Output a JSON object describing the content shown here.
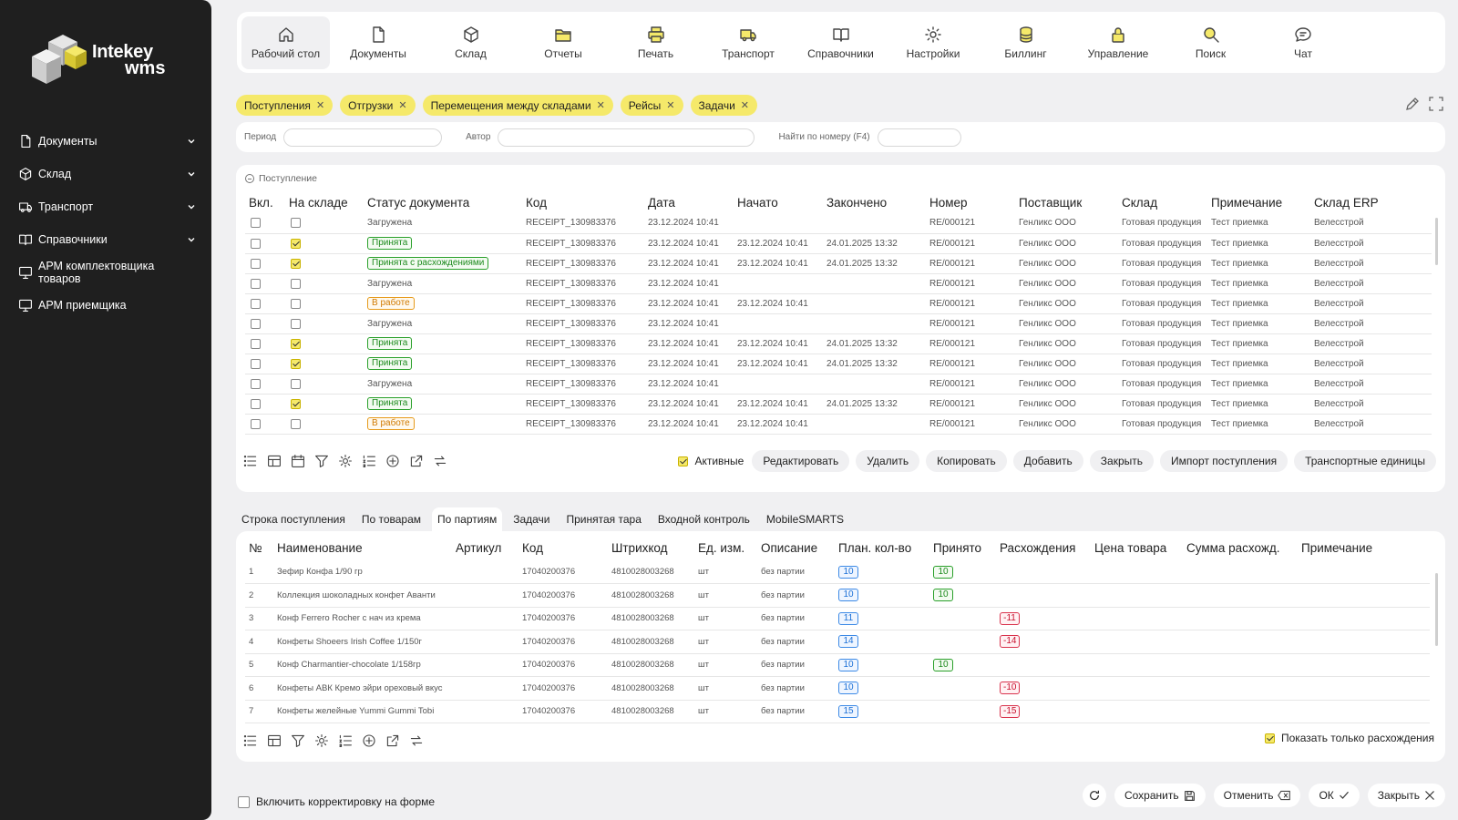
{
  "brand": {
    "name_line1": "Intekey",
    "name_line2": "wms"
  },
  "sidebar": {
    "items": [
      {
        "label": "Документы",
        "icon": "document-icon",
        "has_chevron": true
      },
      {
        "label": "Склад",
        "icon": "box-icon",
        "has_chevron": true
      },
      {
        "label": "Транспорт",
        "icon": "truck-icon",
        "has_chevron": true
      },
      {
        "label": "Справочники",
        "icon": "book-icon",
        "has_chevron": true
      },
      {
        "label": "АРМ комплектовщика товаров",
        "icon": "monitor-icon",
        "has_chevron": false
      },
      {
        "label": "АРМ приемщика",
        "icon": "monitor-icon",
        "has_chevron": false
      }
    ]
  },
  "topnav": {
    "items": [
      {
        "label": "Рабочий стол",
        "icon": "home-icon",
        "active": true
      },
      {
        "label": "Документы",
        "icon": "document-icon"
      },
      {
        "label": "Склад",
        "icon": "box-icon"
      },
      {
        "label": "Отчеты",
        "icon": "folder-icon"
      },
      {
        "label": "Печать",
        "icon": "printer-icon"
      },
      {
        "label": "Транспорт",
        "icon": "truck-icon"
      },
      {
        "label": "Справочники",
        "icon": "book-icon"
      },
      {
        "label": "Настройки",
        "icon": "gear-icon"
      },
      {
        "label": "Биллинг",
        "icon": "coins-icon"
      },
      {
        "label": "Управление",
        "icon": "lock-icon"
      },
      {
        "label": "Поиск",
        "icon": "search-icon"
      },
      {
        "label": "Чат",
        "icon": "chat-icon"
      }
    ]
  },
  "chips": [
    "Поступления",
    "Отгрузки",
    "Перемещения между складами",
    "Рейсы",
    "Задачи"
  ],
  "filters": {
    "period": "Период",
    "author": "Автор",
    "find_by_number": "Найти по номеру (F4)"
  },
  "receipts": {
    "section_title": "Поступление",
    "columns": [
      "Вкл.",
      "На складе",
      "Статус документа",
      "Код",
      "Дата",
      "Начато",
      "Закончено",
      "Номер",
      "Поставщик",
      "Склад",
      "Примечание",
      "Склад ERP"
    ],
    "rows": [
      {
        "incl": false,
        "onstock": false,
        "status": "Загружена",
        "status_type": "plain",
        "code": "RECEIPT_130983376",
        "date": "23.12.2024 10:41",
        "started": "",
        "finished": "",
        "number": "RE/000121",
        "supplier": "Генликс ООО",
        "warehouse": "Готовая продукция",
        "note": "Тест приемка",
        "erp": "Велесстрой"
      },
      {
        "incl": false,
        "onstock": true,
        "status": "Принята",
        "status_type": "green",
        "code": "RECEIPT_130983376",
        "date": "23.12.2024 10:41",
        "started": "23.12.2024 10:41",
        "finished": "24.01.2025 13:32",
        "number": "RE/000121",
        "supplier": "Генликс ООО",
        "warehouse": "Готовая продукция",
        "note": "Тест приемка",
        "erp": "Велесстрой"
      },
      {
        "incl": false,
        "onstock": true,
        "status": "Принята с расхождениями",
        "status_type": "green",
        "code": "RECEIPT_130983376",
        "date": "23.12.2024 10:41",
        "started": "23.12.2024 10:41",
        "finished": "24.01.2025 13:32",
        "number": "RE/000121",
        "supplier": "Генликс ООО",
        "warehouse": "Готовая продукция",
        "note": "Тест приемка",
        "erp": "Велесстрой"
      },
      {
        "incl": false,
        "onstock": false,
        "status": "Загружена",
        "status_type": "plain",
        "code": "RECEIPT_130983376",
        "date": "23.12.2024 10:41",
        "started": "",
        "finished": "",
        "number": "RE/000121",
        "supplier": "Генликс ООО",
        "warehouse": "Готовая продукция",
        "note": "Тест приемка",
        "erp": "Велесстрой"
      },
      {
        "incl": false,
        "onstock": false,
        "status": "В работе",
        "status_type": "orange",
        "code": "RECEIPT_130983376",
        "date": "23.12.2024 10:41",
        "started": "23.12.2024 10:41",
        "finished": "",
        "number": "RE/000121",
        "supplier": "Генликс ООО",
        "warehouse": "Готовая продукция",
        "note": "Тест приемка",
        "erp": "Велесстрой"
      },
      {
        "incl": false,
        "onstock": false,
        "status": "Загружена",
        "status_type": "plain",
        "code": "RECEIPT_130983376",
        "date": "23.12.2024 10:41",
        "started": "",
        "finished": "",
        "number": "RE/000121",
        "supplier": "Генликс ООО",
        "warehouse": "Готовая продукция",
        "note": "Тест приемка",
        "erp": "Велесстрой"
      },
      {
        "incl": false,
        "onstock": true,
        "status": "Принята",
        "status_type": "green",
        "code": "RECEIPT_130983376",
        "date": "23.12.2024 10:41",
        "started": "23.12.2024 10:41",
        "finished": "24.01.2025 13:32",
        "number": "RE/000121",
        "supplier": "Генликс ООО",
        "warehouse": "Готовая продукция",
        "note": "Тест приемка",
        "erp": "Велесстрой"
      },
      {
        "incl": false,
        "onstock": true,
        "status": "Принята",
        "status_type": "green",
        "code": "RECEIPT_130983376",
        "date": "23.12.2024 10:41",
        "started": "23.12.2024 10:41",
        "finished": "24.01.2025 13:32",
        "number": "RE/000121",
        "supplier": "Генликс ООО",
        "warehouse": "Готовая продукция",
        "note": "Тест приемка",
        "erp": "Велесстрой"
      },
      {
        "incl": false,
        "onstock": false,
        "status": "Загружена",
        "status_type": "plain",
        "code": "RECEIPT_130983376",
        "date": "23.12.2024 10:41",
        "started": "",
        "finished": "",
        "number": "RE/000121",
        "supplier": "Генликс ООО",
        "warehouse": "Готовая продукция",
        "note": "Тест приемка",
        "erp": "Велесстрой"
      },
      {
        "incl": false,
        "onstock": true,
        "status": "Принята",
        "status_type": "green",
        "code": "RECEIPT_130983376",
        "date": "23.12.2024 10:41",
        "started": "23.12.2024 10:41",
        "finished": "24.01.2025 13:32",
        "number": "RE/000121",
        "supplier": "Генликс ООО",
        "warehouse": "Готовая продукция",
        "note": "Тест приемка",
        "erp": "Велесстрой"
      },
      {
        "incl": false,
        "onstock": false,
        "status": "В работе",
        "status_type": "orange",
        "code": "RECEIPT_130983376",
        "date": "23.12.2024 10:41",
        "started": "23.12.2024 10:41",
        "finished": "",
        "number": "RE/000121",
        "supplier": "Генликс ООО",
        "warehouse": "Готовая продукция",
        "note": "Тест приемка",
        "erp": "Велесстрой"
      }
    ],
    "active_label": "Активные",
    "actions": [
      "Редактировать",
      "Удалить",
      "Копировать",
      "Добавить",
      "Закрыть",
      "Импорт поступления",
      "Транспортные единицы"
    ]
  },
  "tabs": [
    {
      "label": "Строка поступления",
      "active": false
    },
    {
      "label": "По товарам",
      "active": false
    },
    {
      "label": "По партиям",
      "active": true
    },
    {
      "label": "Задачи",
      "active": false
    },
    {
      "label": "Принятая тара",
      "active": false
    },
    {
      "label": "Входной контроль",
      "active": false
    },
    {
      "label": "MobileSMARTS",
      "active": false
    }
  ],
  "items": {
    "columns": [
      "№",
      "Наименование",
      "Артикул",
      "Код",
      "Штрихкод",
      "Ед. изм.",
      "Описание",
      "План. кол-во",
      "Принято",
      "Расхождения",
      "Цена товара",
      "Сумма расхожд.",
      "Примечание"
    ],
    "rows": [
      {
        "n": "1",
        "name": "Зефир Конфа 1/90 гр",
        "article": "",
        "code": "17040200376",
        "barcode": "4810028003268",
        "unit": "шт",
        "desc": "без партии",
        "plan": "10",
        "accepted": "10",
        "diff": ""
      },
      {
        "n": "2",
        "name": "Коллекция шоколадных конфет Аванти",
        "article": "",
        "code": "17040200376",
        "barcode": "4810028003268",
        "unit": "шт",
        "desc": "без партии",
        "plan": "10",
        "accepted": "10",
        "diff": ""
      },
      {
        "n": "3",
        "name": "Конф Ferrero Rocher с нач из крема",
        "article": "",
        "code": "17040200376",
        "barcode": "4810028003268",
        "unit": "шт",
        "desc": "без партии",
        "plan": "11",
        "accepted": "",
        "diff": "-11"
      },
      {
        "n": "4",
        "name": "Конфеты Shoeers Irish Coffee 1/150г",
        "article": "",
        "code": "17040200376",
        "barcode": "4810028003268",
        "unit": "шт",
        "desc": "без партии",
        "plan": "14",
        "accepted": "",
        "diff": "-14"
      },
      {
        "n": "5",
        "name": "Конф Charmantier-chocolate 1/158гр",
        "article": "",
        "code": "17040200376",
        "barcode": "4810028003268",
        "unit": "шт",
        "desc": "без партии",
        "plan": "10",
        "accepted": "10",
        "diff": ""
      },
      {
        "n": "6",
        "name": "Конфеты АВК Кремо эйри ореховый вкус",
        "article": "",
        "code": "17040200376",
        "barcode": "4810028003268",
        "unit": "шт",
        "desc": "без партии",
        "plan": "10",
        "accepted": "",
        "diff": "-10"
      },
      {
        "n": "7",
        "name": "Конфеты желейные Yummi Gummi Tobi",
        "article": "",
        "code": "17040200376",
        "barcode": "4810028003268",
        "unit": "шт",
        "desc": "без партии",
        "plan": "15",
        "accepted": "",
        "diff": "-15"
      }
    ],
    "show_only_diff": "Показать только расхождения"
  },
  "footer": {
    "enable_correction": "Включить корректировку на форме",
    "save": "Сохранить",
    "cancel": "Отменить",
    "ok": "ОК",
    "close": "Закрыть"
  },
  "colors": {
    "accent": "#f5e96a",
    "sidebar": "#1f1f1f",
    "green": "#2aa02a",
    "orange": "#e69a1a",
    "blue": "#3d8ae6",
    "red": "#d9334d"
  }
}
